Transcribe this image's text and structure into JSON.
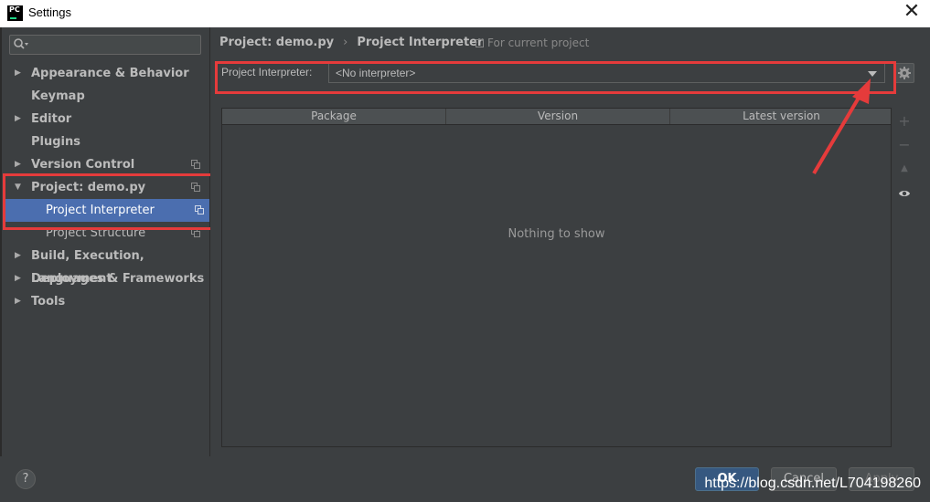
{
  "window": {
    "title": "Settings",
    "app_icon_text": "PC",
    "close_glyph": "✕"
  },
  "search": {
    "placeholder": "",
    "value": ""
  },
  "sidebar": {
    "items": [
      {
        "label": "Appearance & Behavior",
        "expandable": true,
        "arrow": "▶"
      },
      {
        "label": "Keymap",
        "expandable": false
      },
      {
        "label": "Editor",
        "expandable": true,
        "arrow": "▶"
      },
      {
        "label": "Plugins",
        "expandable": false
      },
      {
        "label": "Version Control",
        "expandable": true,
        "arrow": "▶",
        "copy_icon": true
      },
      {
        "label": "Project: demo.py",
        "expandable": true,
        "arrow": "▼",
        "copy_icon": true
      },
      {
        "label": "Project Interpreter",
        "child": true,
        "selected": true,
        "copy_icon": true
      },
      {
        "label": "Project Structure",
        "child": true,
        "copy_icon": true
      },
      {
        "label": "Build, Execution, Deployment",
        "expandable": true,
        "arrow": "▶"
      },
      {
        "label": "Languages & Frameworks",
        "expandable": true,
        "arrow": "▶"
      },
      {
        "label": "Tools",
        "expandable": true,
        "arrow": "▶"
      }
    ]
  },
  "breadcrumb": {
    "project": "Project: demo.py",
    "separator": "›",
    "page": "Project Interpreter",
    "scope": "For current project"
  },
  "interpreter": {
    "label": "Project Interpreter:",
    "value": "<No interpreter>"
  },
  "packages_table": {
    "columns": [
      "Package",
      "Version",
      "Latest version"
    ],
    "rows": [],
    "empty_text": "Nothing to show"
  },
  "table_tools": {
    "add": "+",
    "remove": "−",
    "up": "▲"
  },
  "buttons": {
    "help": "?",
    "ok": "OK",
    "cancel": "Cancel",
    "apply": "Apply"
  },
  "watermark": "https://blog.csdn.net/L704198260",
  "colors": {
    "selection": "#4b6eaf",
    "annotation_red": "#e53b3b",
    "background": "#3c3f41",
    "ok_button": "#365880"
  }
}
